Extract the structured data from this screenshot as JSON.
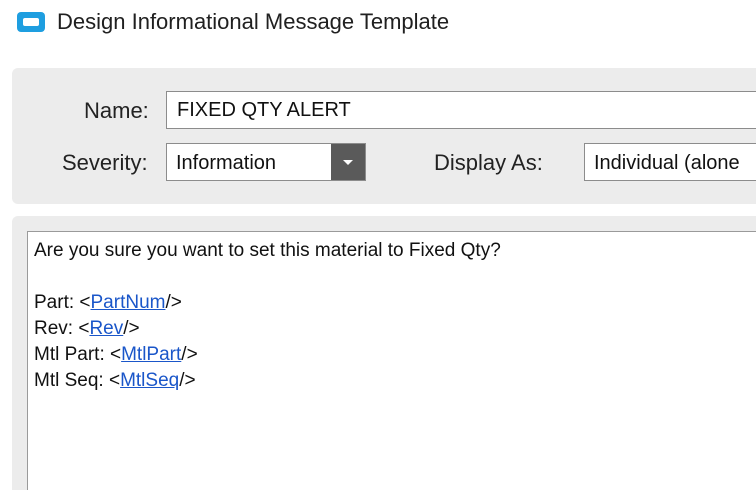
{
  "window": {
    "title": "Design Informational Message Template",
    "icon": "message-template-icon"
  },
  "form": {
    "name_label": "Name:",
    "name_value": "FIXED QTY ALERT",
    "severity_label": "Severity:",
    "severity_value": "Information",
    "display_label": "Display As:",
    "display_value": "Individual (alone"
  },
  "message": {
    "question": "Are you sure you want to set this material to Fixed Qty?",
    "fields": [
      {
        "prefix": "Part: <",
        "tag": "PartNum",
        "suffix": "/>"
      },
      {
        "prefix": "Rev: <",
        "tag": "Rev",
        "suffix": "/>"
      },
      {
        "prefix": "Mtl Part: <",
        "tag": "MtlPart",
        "suffix": "/>"
      },
      {
        "prefix": "Mtl Seq: <",
        "tag": "MtlSeq",
        "suffix": "/>"
      }
    ]
  },
  "colors": {
    "accent": "#1e9ee0",
    "link": "#1a56c9",
    "panel": "#ececec",
    "dropdown_button": "#5a5a5a"
  }
}
